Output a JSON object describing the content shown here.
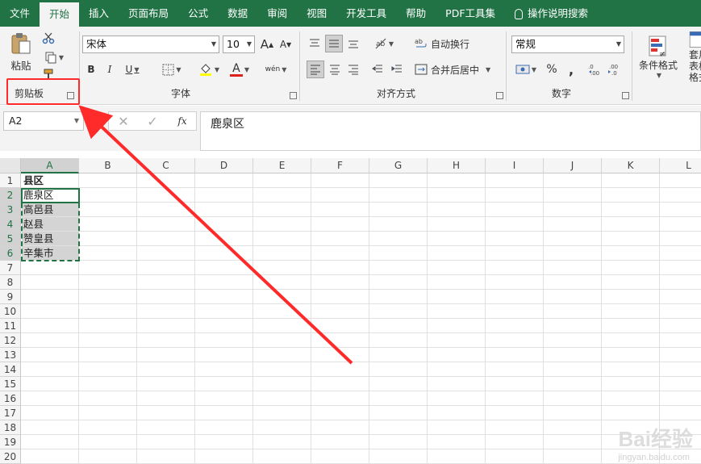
{
  "tabs": [
    "文件",
    "开始",
    "插入",
    "页面布局",
    "公式",
    "数据",
    "审阅",
    "视图",
    "开发工具",
    "帮助",
    "PDF工具集",
    "操作说明搜索"
  ],
  "ribbon": {
    "clipboard": {
      "paste": "粘贴",
      "label": "剪贴板"
    },
    "font": {
      "name": "宋体",
      "size": "10",
      "bold": "B",
      "italic": "I",
      "underline": "U",
      "grow": "A",
      "shrink": "A",
      "color": "A",
      "wen": "wén",
      "label": "字体"
    },
    "align": {
      "wrap": "自动换行",
      "merge": "合并后居中",
      "label": "对齐方式"
    },
    "number": {
      "format": "常规",
      "percent": "%",
      "comma": ",",
      "label": "数字"
    },
    "styles": {
      "cond": "条件格式",
      "table": "套用表格格式"
    }
  },
  "formula_bar": {
    "name_box": "A2",
    "fx": "fx",
    "content": "鹿泉区"
  },
  "columns": [
    "A",
    "B",
    "C",
    "D",
    "E",
    "F",
    "G",
    "H",
    "I",
    "J",
    "K",
    "L"
  ],
  "rows": [
    "1",
    "2",
    "3",
    "4",
    "5",
    "6",
    "7",
    "8",
    "9",
    "10",
    "11",
    "12",
    "13",
    "14",
    "15",
    "16",
    "17",
    "18",
    "19",
    "20"
  ],
  "cells": [
    "县区",
    "鹿泉区",
    "高邑县",
    "赵县",
    "赞皇县",
    "辛集市"
  ],
  "watermark": {
    "main": "Bai经验",
    "sub": "jingyan.baidu.com"
  }
}
